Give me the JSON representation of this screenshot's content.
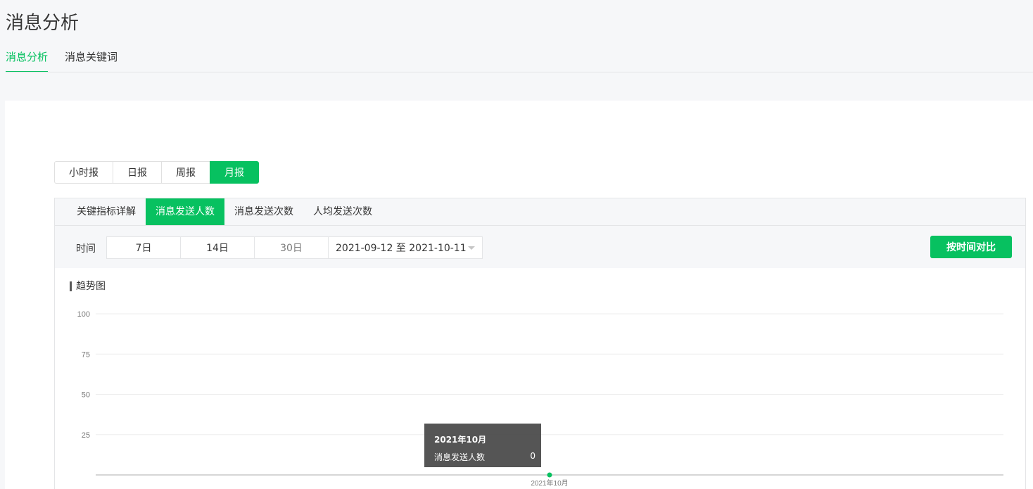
{
  "page": {
    "title": "消息分析"
  },
  "tabs": [
    {
      "label": "消息分析",
      "active": true
    },
    {
      "label": "消息关键词",
      "active": false
    }
  ],
  "periods": [
    {
      "label": "小时报",
      "active": false
    },
    {
      "label": "日报",
      "active": false
    },
    {
      "label": "周报",
      "active": false
    },
    {
      "label": "月报",
      "active": true
    }
  ],
  "metric_tabs": [
    {
      "label": "关键指标详解",
      "active": false
    },
    {
      "label": "消息发送人数",
      "active": true
    },
    {
      "label": "消息发送次数",
      "active": false
    },
    {
      "label": "人均发送次数",
      "active": false
    }
  ],
  "filter": {
    "label": "时间",
    "ranges": [
      "7日",
      "14日",
      "30日"
    ],
    "date_range": "2021-09-12 至 2021-10-11",
    "compare_label": "按时间对比"
  },
  "trend": {
    "title": "趋势图"
  },
  "tooltip": {
    "title": "2021年10月",
    "series_name": "消息发送人数",
    "value": "0"
  },
  "colors": {
    "accent": "#07c160",
    "tooltip_bg": "#464646"
  },
  "chart_data": {
    "type": "line",
    "categories": [
      "2021年10月"
    ],
    "series": [
      {
        "name": "消息发送人数",
        "values": [
          0
        ]
      }
    ],
    "yticks": [
      25,
      50,
      75,
      100
    ],
    "ylim": [
      0,
      100
    ],
    "grid": true
  }
}
